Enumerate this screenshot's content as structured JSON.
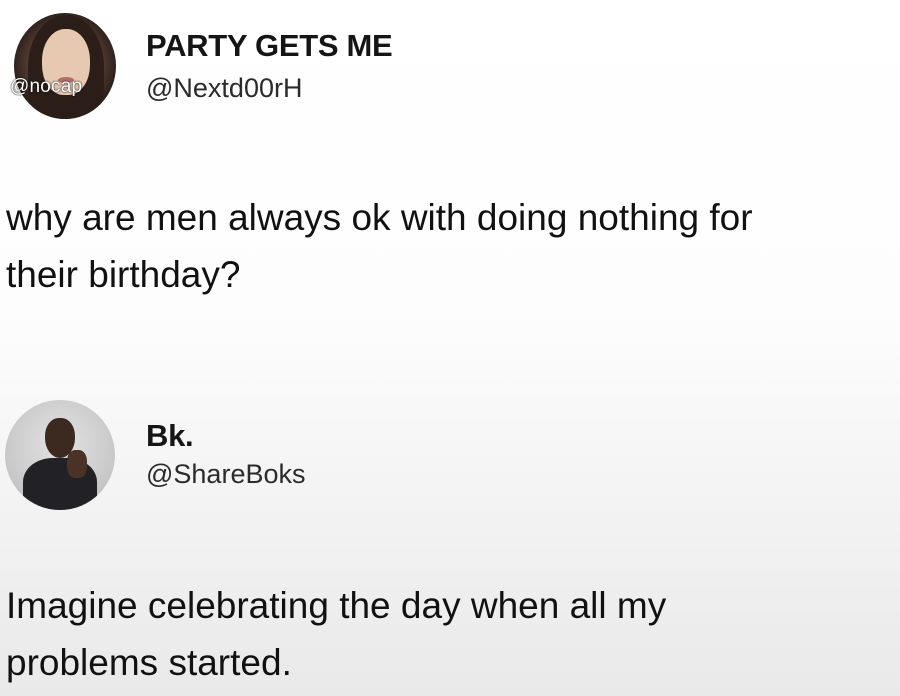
{
  "posts": [
    {
      "display_name": "PARTY GETS ME",
      "handle": "@Nextd00rH",
      "avatar_watermark": "@nocap",
      "text_lines": [
        "why are men always ok with doing nothing for",
        "their birthday?"
      ]
    },
    {
      "display_name": "Bk.",
      "handle": "@ShareBoks",
      "text_lines": [
        "Imagine celebrating the day when all my",
        "problems started."
      ]
    }
  ]
}
